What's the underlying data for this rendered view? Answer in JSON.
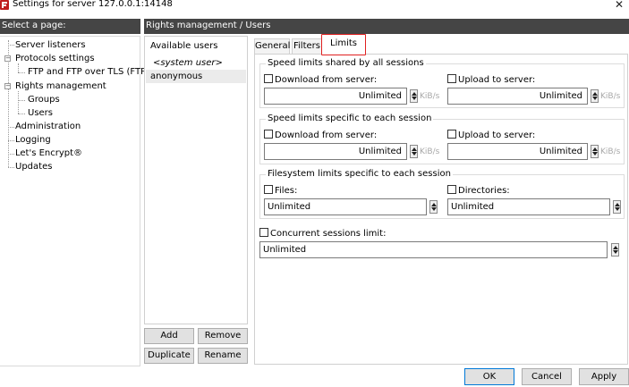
{
  "window": {
    "title": "Settings for server 127.0.0.1:14148",
    "icon": "filezilla-server-icon",
    "close_glyph": "✕"
  },
  "left_header": "Select a page:",
  "right_header": "Rights management / Users",
  "tree": {
    "items": [
      {
        "label": "Server listeners"
      },
      {
        "label": "Protocols settings",
        "expander": "−"
      },
      {
        "label": "FTP and FTP over TLS (FTPS)"
      },
      {
        "label": "Rights management",
        "expander": "−"
      },
      {
        "label": "Groups"
      },
      {
        "label": "Users"
      },
      {
        "label": "Administration"
      },
      {
        "label": "Logging"
      },
      {
        "label": "Let's Encrypt®"
      },
      {
        "label": "Updates"
      }
    ]
  },
  "users": {
    "header": "Available users",
    "items": [
      "<system user>",
      "anonymous"
    ],
    "selected": "anonymous",
    "buttons": {
      "add": "Add",
      "remove": "Remove",
      "duplicate": "Duplicate",
      "rename": "Rename"
    }
  },
  "tabs": [
    "General",
    "Filters",
    "Limits"
  ],
  "active_tab": "Limits",
  "limits": {
    "shared": {
      "title": "Speed limits shared by all sessions",
      "download_label": "Download from server:",
      "download_value": "Unlimited",
      "upload_label": "Upload to server:",
      "upload_value": "Unlimited",
      "unit": "KiB/s"
    },
    "per_session": {
      "title": "Speed limits specific to each session",
      "download_label": "Download from server:",
      "download_value": "Unlimited",
      "upload_label": "Upload to server:",
      "upload_value": "Unlimited",
      "unit": "KiB/s"
    },
    "filesystem": {
      "title": "Filesystem limits specific to each session",
      "files_label": "Files:",
      "files_value": "Unlimited",
      "dirs_label": "Directories:",
      "dirs_value": "Unlimited"
    },
    "concurrent": {
      "label": "Concurrent sessions limit:",
      "value": "Unlimited"
    }
  },
  "dialog_buttons": {
    "ok": "OK",
    "cancel": "Cancel",
    "apply": "Apply"
  },
  "colors": {
    "header_bg": "#454545",
    "active_tab_border": "#e02020",
    "selected_row": "#ebebeb"
  }
}
